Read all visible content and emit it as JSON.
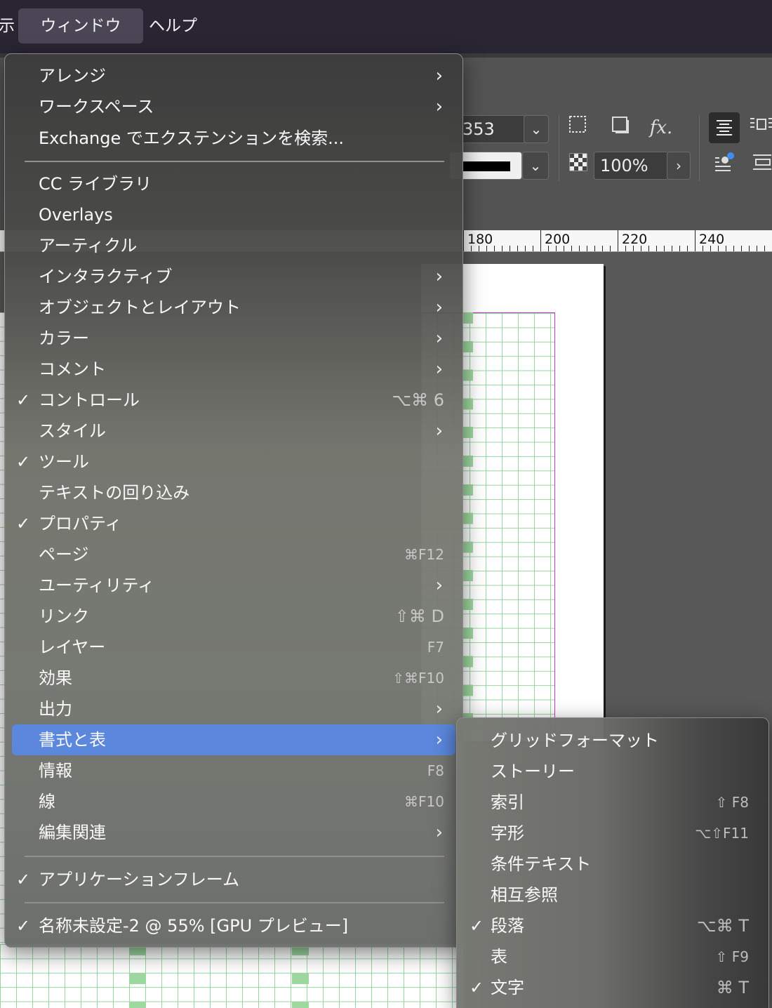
{
  "menubar": {
    "view": "示",
    "window": "ウィンドウ",
    "help": "ヘルプ"
  },
  "control_panel": {
    "width_value": "353 mn",
    "opacity_value": "100%",
    "fx_label": "fx."
  },
  "ruler": {
    "labels": [
      "180",
      "200",
      "220",
      "240"
    ]
  },
  "window_menu": {
    "items": [
      {
        "label": "アレンジ",
        "submenu": true
      },
      {
        "label": "ワークスペース",
        "submenu": true
      },
      {
        "label": "Exchange でエクステンションを検索..."
      },
      {
        "label": "CC ライブラリ"
      },
      {
        "label": "Overlays"
      },
      {
        "label": "アーティクル"
      },
      {
        "label": "インタラクティブ",
        "submenu": true
      },
      {
        "label": "オブジェクトとレイアウト",
        "submenu": true
      },
      {
        "label": "カラー",
        "submenu": true
      },
      {
        "label": "コメント",
        "submenu": true
      },
      {
        "label": "コントロール",
        "checked": true,
        "shortcut": "⌥⌘ 6"
      },
      {
        "label": "スタイル",
        "submenu": true
      },
      {
        "label": "ツール",
        "checked": true
      },
      {
        "label": "テキストの回り込み"
      },
      {
        "label": "プロパティ",
        "checked": true
      },
      {
        "label": "ページ",
        "shortcut": "⌘F12"
      },
      {
        "label": "ユーティリティ",
        "submenu": true
      },
      {
        "label": "リンク",
        "shortcut": "⇧⌘ D"
      },
      {
        "label": "レイヤー",
        "shortcut": "F7"
      },
      {
        "label": "効果",
        "shortcut": "⇧⌘F10"
      },
      {
        "label": "出力",
        "submenu": true
      },
      {
        "label": "書式と表",
        "submenu": true,
        "highlighted": true
      },
      {
        "label": "情報",
        "shortcut": "F8"
      },
      {
        "label": "線",
        "shortcut": "⌘F10"
      },
      {
        "label": "編集関連",
        "submenu": true
      },
      {
        "label": "アプリケーションフレーム",
        "checked": true
      },
      {
        "label": "名称未設定-2 @ 55% [GPU プレビュー]",
        "checked": true
      }
    ]
  },
  "submenu": {
    "items": [
      {
        "label": "グリッドフォーマット"
      },
      {
        "label": "ストーリー"
      },
      {
        "label": "索引",
        "shortcut": "⇧ F8"
      },
      {
        "label": "字形",
        "shortcut": "⌥⇧F11"
      },
      {
        "label": "条件テキスト"
      },
      {
        "label": "相互参照"
      },
      {
        "label": "段落",
        "checked": true,
        "shortcut": "⌥⌘ T"
      },
      {
        "label": "表",
        "shortcut": "⇧ F9"
      },
      {
        "label": "文字",
        "checked": true,
        "shortcut": "⌘ T"
      }
    ]
  },
  "glyphs": {
    "check": "✓",
    "arrow": "›",
    "chevron_down": "⌄",
    "chevron_right": "›"
  },
  "colors": {
    "highlight": "#5b87dc",
    "menubar": "#2a2533",
    "margin_guide": "#cc33cc",
    "grid_green": "#9ed8a0"
  }
}
